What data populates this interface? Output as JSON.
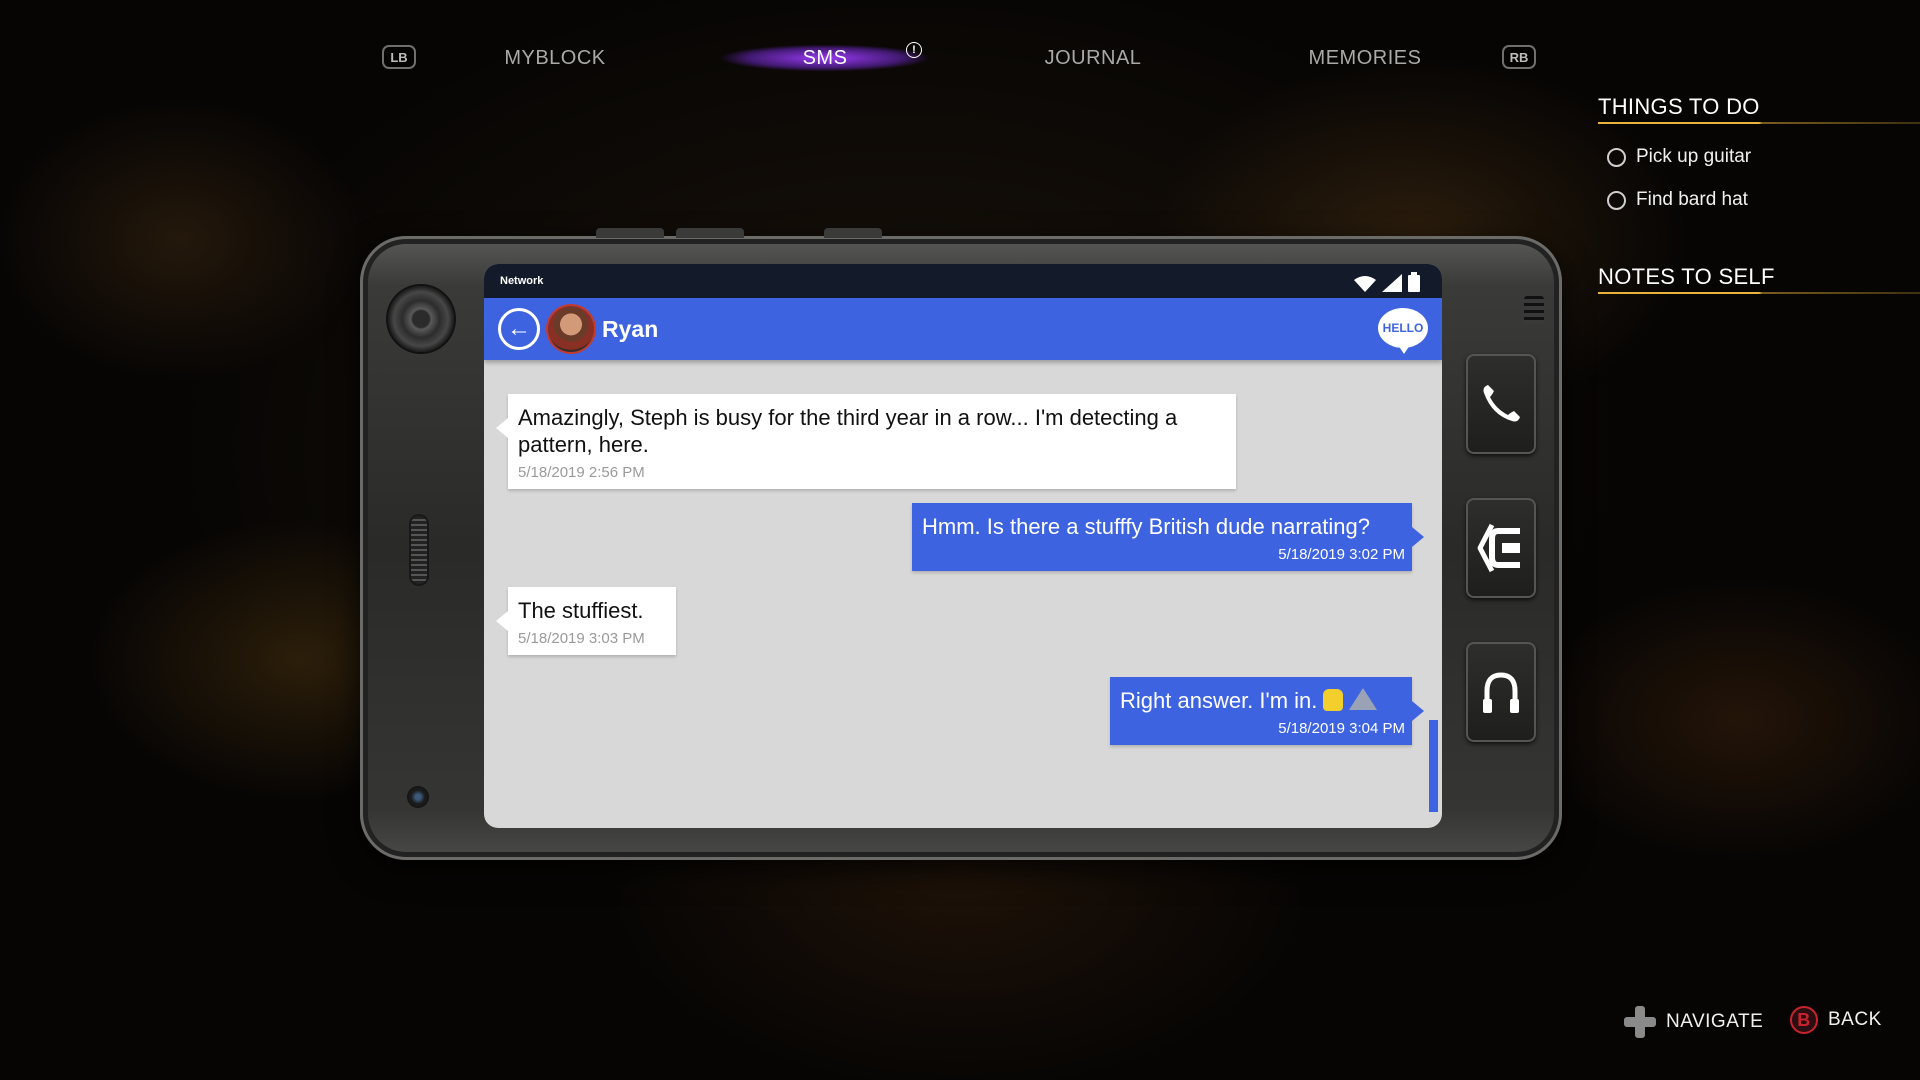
{
  "nav": {
    "left_bumper": "LB",
    "right_bumper": "RB",
    "tabs": [
      {
        "label": "MYBLOCK"
      },
      {
        "label": "SMS"
      },
      {
        "label": "JOURNAL"
      },
      {
        "label": "MEMORIES"
      }
    ],
    "active_tab": "SMS",
    "alert_glyph": "!"
  },
  "side_panel": {
    "things_to_do_title": "THINGS TO DO",
    "todos": [
      {
        "label": "Pick up guitar",
        "done": false
      },
      {
        "label": "Find bard hat",
        "done": false
      }
    ],
    "notes_title": "NOTES TO SELF"
  },
  "phone": {
    "status": {
      "network_label": "Network"
    },
    "chat": {
      "contact_name": "Ryan",
      "hello_badge": "HELLO",
      "back_glyph": "←",
      "messages": [
        {
          "direction": "in",
          "text": "Amazingly, Steph is busy for the third year in a row... I'm detecting a pattern, here.",
          "time": "5/18/2019 2:56 PM"
        },
        {
          "direction": "out",
          "text": "Hmm. Is there a stufffy British dude narrating?",
          "time": "5/18/2019 3:02 PM"
        },
        {
          "direction": "in",
          "text": "The stuffiest.",
          "time": "5/18/2019 3:03 PM"
        },
        {
          "direction": "out",
          "text": "Right answer. I'm in.",
          "time": "5/18/2019 3:04 PM",
          "emoji": [
            "rock-hand",
            "mountain"
          ]
        }
      ]
    },
    "side_buttons": [
      "phone-call-icon",
      "contacts-back-icon",
      "headphones-icon"
    ]
  },
  "prompts": {
    "navigate": "NAVIGATE",
    "back": "BACK",
    "back_button_glyph": "B"
  },
  "colors": {
    "accent_blue": "#3d63e0",
    "heading_underline": "#e8b33a",
    "nav_glow": "#a03cff",
    "b_button": "#c8222e"
  }
}
